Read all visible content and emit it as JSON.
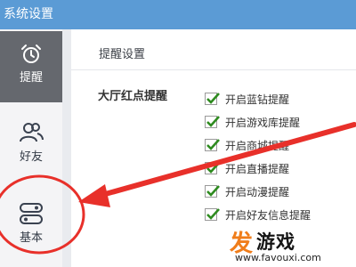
{
  "window": {
    "title": "系统设置"
  },
  "sidebar": {
    "items": [
      {
        "label": "提醒",
        "icon": "alarm-clock-icon",
        "active": true
      },
      {
        "label": "好友",
        "icon": "friends-icon",
        "active": false
      },
      {
        "label": "基本",
        "icon": "toggle-switch-icon",
        "active": false
      }
    ]
  },
  "panel": {
    "title": "提醒设置",
    "group_label": "大厅红点提醒",
    "options": [
      {
        "label": "开启蓝钻提醒",
        "checked": true
      },
      {
        "label": "开启游戏库提醒",
        "checked": true
      },
      {
        "label": "开启商城提醒",
        "checked": true
      },
      {
        "label": "开启直播提醒",
        "checked": true
      },
      {
        "label": "开启动漫提醒",
        "checked": true
      },
      {
        "label": "开启好友信息提醒",
        "checked": true
      }
    ]
  },
  "annotation": {
    "arrow_color": "#e8302a",
    "circle_color": "#e8302a"
  },
  "watermark": {
    "brand_first": "发",
    "brand_rest": "游戏",
    "url": "www.favouxi.com"
  },
  "colors": {
    "titlebar": "#5b9bd5",
    "sidebar_active": "#65686e",
    "checkmark": "#2e8b1f"
  }
}
